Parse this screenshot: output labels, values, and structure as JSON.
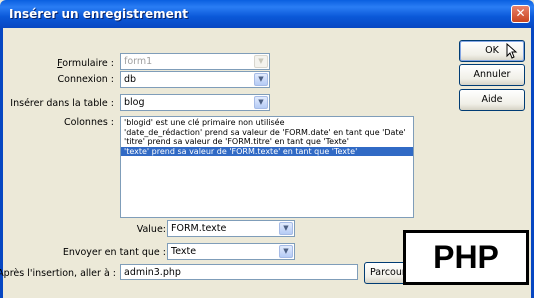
{
  "window": {
    "title": "Insérer un enregistrement",
    "close_label": "✕"
  },
  "form": {
    "formulaire": {
      "label_first": "F",
      "label_rest": "ormulaire :",
      "value": "form1"
    },
    "connexion": {
      "label": "Connexion :",
      "value": "db"
    },
    "table": {
      "label": "Insérer dans la table :",
      "value": "blog"
    },
    "colonnes": {
      "label": "Colonnes :",
      "items": [
        "'blogid' est une clé primaire non utilisée",
        "'date_de_rédaction' prend sa valeur de 'FORM.date' en tant que 'Date'",
        "'titre' prend sa valeur de 'FORM.titre' en tant que 'Texte'",
        "'texte' prend sa valeur de 'FORM.texte' en tant que 'Texte'"
      ],
      "selected_index": 3
    },
    "value": {
      "label": "Value:",
      "value": "FORM.texte"
    },
    "envoyer": {
      "label": "Envoyer en tant que :",
      "value": "Texte"
    },
    "apres": {
      "label": "Après l'insertion, aller à :",
      "value": "admin3.php"
    }
  },
  "buttons": {
    "ok": "OK",
    "annuler": "Annuler",
    "aide": "Aide",
    "parcourir": "Parcourir..."
  },
  "overlay": {
    "php_label": "PHP"
  }
}
